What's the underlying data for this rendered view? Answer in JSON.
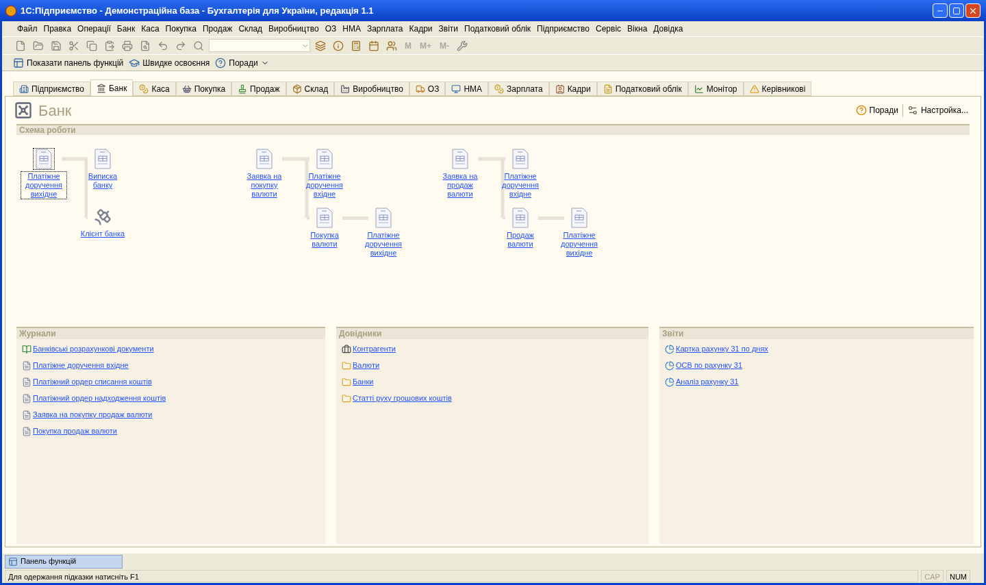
{
  "window": {
    "title": "1С:Підприємство - Демонстраційна база - Бухгалтерія для України, редакція 1.1"
  },
  "menu": [
    "Файл",
    "Правка",
    "Операції",
    "Банк",
    "Каса",
    "Покупка",
    "Продаж",
    "Склад",
    "Виробництво",
    "ОЗ",
    "НМА",
    "Зарплата",
    "Кадри",
    "Звіти",
    "Податковий облік",
    "Підприємство",
    "Сервіс",
    "Вікна",
    "Довідка"
  ],
  "toolbar": {
    "memory_buttons": [
      {
        "label": "M",
        "disabled": true
      },
      {
        "label": "M+",
        "disabled": true
      },
      {
        "label": "M-",
        "disabled": true
      }
    ]
  },
  "quick_toolbar": [
    {
      "label": "Показати панель функцій"
    },
    {
      "label": "Швидке освоєння"
    },
    {
      "label": "Поради",
      "has_menu": true
    }
  ],
  "tabs": [
    {
      "label": "Підприємство",
      "selected": false
    },
    {
      "label": "Банк",
      "selected": true
    },
    {
      "label": "Каса",
      "selected": false
    },
    {
      "label": "Покупка",
      "selected": false
    },
    {
      "label": "Продаж",
      "selected": false
    },
    {
      "label": "Склад",
      "selected": false
    },
    {
      "label": "Виробництво",
      "selected": false
    },
    {
      "label": "ОЗ",
      "selected": false
    },
    {
      "label": "НМА",
      "selected": false
    },
    {
      "label": "Зарплата",
      "selected": false
    },
    {
      "label": "Кадри",
      "selected": false
    },
    {
      "label": "Податковий облік",
      "selected": false
    },
    {
      "label": "Монітор",
      "selected": false
    },
    {
      "label": "Керівникові",
      "selected": false
    }
  ],
  "page": {
    "title": "Банк",
    "actions": [
      "Поради",
      "Настройка..."
    ]
  },
  "scheme": {
    "title": "Схема роботи",
    "groups": [
      {
        "nodes": [
          {
            "label": "Платіжне доручення вихідне",
            "kind": "document",
            "focused": true
          },
          {
            "label": "Виписка банку",
            "kind": "document",
            "focused": false
          },
          {
            "label": "Клієнт банка",
            "kind": "satellite",
            "focused": false
          }
        ]
      },
      {
        "nodes": [
          {
            "label": "Заявка на покупку валюти",
            "kind": "document",
            "focused": false
          },
          {
            "label": "Платіжне доручення вхідне",
            "kind": "document",
            "focused": false
          },
          {
            "label": "Покупка валюти",
            "kind": "document",
            "focused": false
          },
          {
            "label": "Платіжне доручення вихідне",
            "kind": "document",
            "focused": false
          }
        ]
      },
      {
        "nodes": [
          {
            "label": "Заявка на продаж валюти",
            "kind": "document",
            "focused": false
          },
          {
            "label": "Платіжне доручення вхідне",
            "kind": "document",
            "focused": false
          },
          {
            "label": "Продаж валюти",
            "kind": "document",
            "focused": false
          },
          {
            "label": "Платіжне доручення вихідне",
            "kind": "document",
            "focused": false
          }
        ]
      }
    ]
  },
  "panels": [
    {
      "title": "Журнали",
      "items": [
        {
          "label": "Банківські розрахункові документи",
          "kind": "ledger"
        },
        {
          "label": "Платіжне доручення вхідне",
          "kind": "document"
        },
        {
          "label": "Платіжний ордер списання коштів",
          "kind": "document"
        },
        {
          "label": "Платіжний ордер надходження коштів",
          "kind": "document"
        },
        {
          "label": "Заявка на покупку продаж валюти",
          "kind": "document"
        },
        {
          "label": "Покупка продаж валюти",
          "kind": "document"
        }
      ]
    },
    {
      "title": "Довідники",
      "items": [
        {
          "label": "Контрагенти",
          "kind": "counterparty"
        },
        {
          "label": "Валюти",
          "kind": "folder"
        },
        {
          "label": "Банки",
          "kind": "folder"
        },
        {
          "label": "Статті руху грошових коштів",
          "kind": "folder"
        }
      ]
    },
    {
      "title": "Звіти",
      "items": [
        {
          "label": "Картка рахунку 31 по днях",
          "kind": "report"
        },
        {
          "label": "ОСВ по рахунку 31",
          "kind": "report"
        },
        {
          "label": "Аналіз рахунку 31",
          "kind": "report"
        }
      ]
    }
  ],
  "taskbar": [
    {
      "label": "Панель функцій",
      "selected": true
    }
  ],
  "status_bar": {
    "hint": "Для одержання підказки натисніть F1",
    "indicators": [
      {
        "label": "CAP",
        "on": false
      },
      {
        "label": "NUM",
        "on": true
      }
    ]
  }
}
